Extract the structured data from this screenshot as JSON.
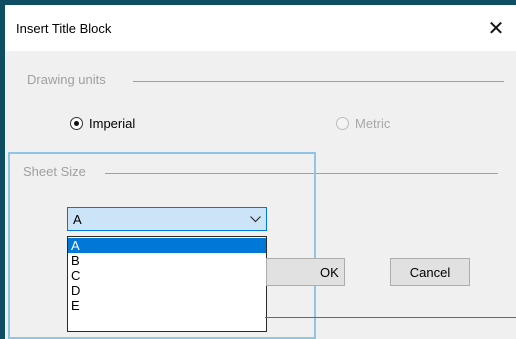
{
  "dialog": {
    "title": "Insert Title Block",
    "close_glyph": "✕"
  },
  "drawing_units": {
    "label": "Drawing units",
    "options": [
      {
        "label": "Imperial",
        "checked": true,
        "enabled": true
      },
      {
        "label": "Metric",
        "checked": false,
        "enabled": false
      }
    ]
  },
  "sheet_size": {
    "label": "Sheet Size",
    "selected": "A",
    "options": [
      "A",
      "B",
      "C",
      "D",
      "E"
    ]
  },
  "buttons": {
    "ok_label": "OK",
    "cancel_label": "Cancel"
  },
  "icons": {
    "close": "close-icon",
    "dropdown": "chevron-down-icon",
    "radio_checked": "radio-checked-icon",
    "radio_unchecked": "radio-unchecked-icon"
  },
  "colors": {
    "accent": "#0078d7",
    "selected_field_bg": "#cce4f7",
    "focus_frame": "#8fc6e6",
    "desktop_bg": "#0f4d63"
  }
}
